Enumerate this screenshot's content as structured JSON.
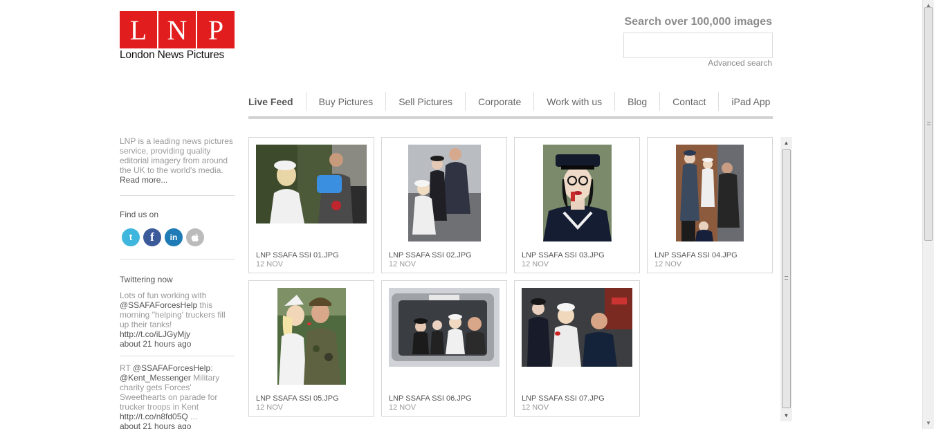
{
  "logo": {
    "letters": [
      "L",
      "N",
      "P"
    ],
    "text": "London News Pictures",
    "brand_color": "#e21d1d"
  },
  "search": {
    "title": "Search over 100,000 images",
    "value": "",
    "advanced_label": "Advanced search"
  },
  "nav": {
    "items": [
      {
        "label": "Live Feed",
        "active": true
      },
      {
        "label": "Buy Pictures"
      },
      {
        "label": "Sell Pictures"
      },
      {
        "label": "Corporate"
      },
      {
        "label": "Work with us"
      },
      {
        "label": "Blog"
      },
      {
        "label": "Contact"
      },
      {
        "label": "iPad App"
      }
    ]
  },
  "sidebar": {
    "about_text": "LNP is a leading news pictures service, providing quality editorial imagery from around the UK to the world's media.",
    "read_more": "Read more...",
    "find_us": "Find us on",
    "socials": [
      {
        "icon": "twitter-icon",
        "glyph": "t"
      },
      {
        "icon": "facebook-icon",
        "glyph": "f"
      },
      {
        "icon": "linkedin-icon",
        "glyph": "in"
      },
      {
        "icon": "apple-icon",
        "glyph": ""
      }
    ],
    "twitter_heading": "Twittering now",
    "tweets": [
      {
        "pre": "Lots of fun working with ",
        "mention": "@SSAFAForcesHelp",
        "post": " this morning \"helping' truckers fill up their tanks!",
        "link": "http://t.co/iLJGyMjy",
        "time": "about 21 hours ago"
      },
      {
        "pre": "RT ",
        "mention": "@SSAFAForcesHelp",
        "mid": ": ",
        "mention2": "@Kent_Messenger",
        "post": " Military charity gets Forces' Sweethearts on parade for trucker troops in Kent",
        "link": "http://t.co/n8fd05Q",
        "ellipsis": " ...",
        "time": "about 21 hours ago"
      }
    ]
  },
  "images": [
    {
      "caption": "LNP SSAFA SSI 01.JPG",
      "date": "12 NOV"
    },
    {
      "caption": "LNP SSAFA SSI 02.JPG",
      "date": "12 NOV"
    },
    {
      "caption": "LNP SSAFA SSI 03.JPG",
      "date": "12 NOV"
    },
    {
      "caption": "LNP SSAFA SSI 04.JPG",
      "date": "12 NOV"
    },
    {
      "caption": "LNP SSAFA SSI 05.JPG",
      "date": "12 NOV"
    },
    {
      "caption": "LNP SSAFA SSI 06.JPG",
      "date": "12 NOV"
    },
    {
      "caption": "LNP SSAFA SSI 07.JPG",
      "date": "12 NOV"
    }
  ]
}
